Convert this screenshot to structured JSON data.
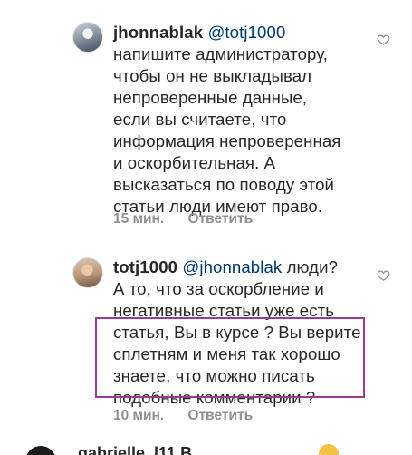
{
  "comments": [
    {
      "author": "jhonnablak",
      "mention": "@totj1000",
      "lead": "напишите администратору,",
      "body": "чтобы он не выкладывал\nнепроверенные данные,\nесли вы считаете, что\nинформация непроверенная\nи оскорбительная. А\nвысказаться по поводу этой\nстатьи люди имеют право.",
      "time": "15 мин.",
      "reply_label": "Ответить",
      "like_icon": "heart-outline-icon"
    },
    {
      "author": "totj1000",
      "mention": "@jhonnablak",
      "lead": "люди?",
      "body": "А то, что за оскорбление и\nнегативные статьи уже есть\nстатья, Вы в курсе ? Вы верите\nсплетням и меня так хорошо\nзнаете, что можно писать\nподобные комментарии ?",
      "time": "10 мин.",
      "reply_label": "Ответить",
      "like_icon": "heart-outline-icon"
    }
  ],
  "next_comment": {
    "author_partial": "gabrielle_l11 B..."
  },
  "colors": {
    "text": "#262626",
    "meta": "#8e8e8e",
    "mention": "#00376b",
    "highlight_border": "#9b3b8f"
  }
}
